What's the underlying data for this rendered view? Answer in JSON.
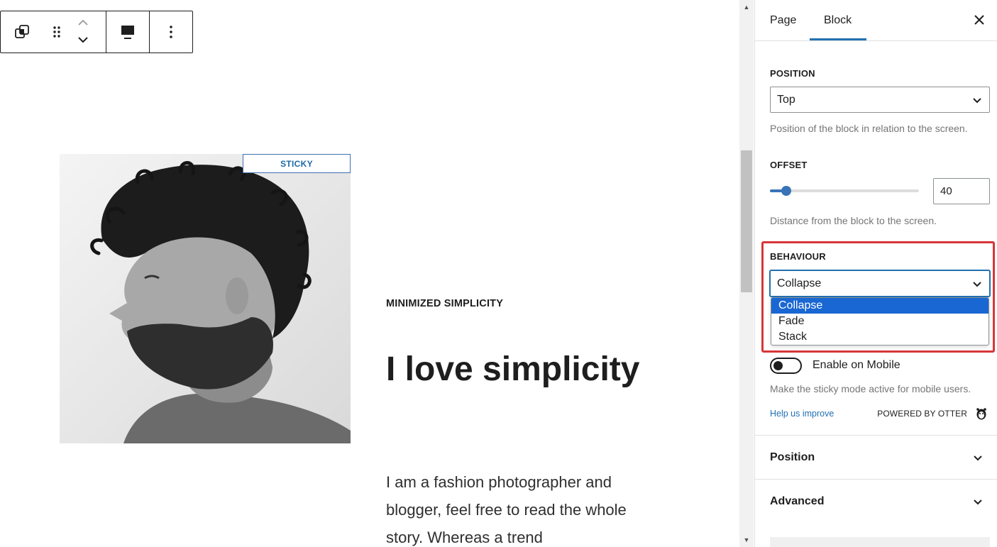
{
  "toolbar": {
    "icons": [
      "duplicate-blocks-icon",
      "drag-handle-icon",
      "move-up-icon",
      "move-down-icon",
      "block-align-icon",
      "more-options-icon"
    ]
  },
  "canvas": {
    "badge": "STICKY",
    "eyebrow": "MINIMIZED SIMPLICITY",
    "headline": "I love simplicity",
    "body": "I am a fashion photographer and blogger, feel free to read the whole story. Whereas a trend"
  },
  "sidebar": {
    "tabs": [
      {
        "label": "Page",
        "active": false
      },
      {
        "label": "Block",
        "active": true
      }
    ],
    "position": {
      "label": "POSITION",
      "value": "Top",
      "help": "Position of the block in relation to the screen."
    },
    "offset": {
      "label": "OFFSET",
      "value": "40",
      "slider_fraction": 0.08,
      "help": "Distance from the block to the screen."
    },
    "behaviour": {
      "label": "BEHAVIOUR",
      "value": "Collapse",
      "options": [
        "Collapse",
        "Fade",
        "Stack"
      ],
      "selected_index": 0
    },
    "mobile": {
      "label": "Enable on Mobile",
      "enabled": false,
      "help": "Make the sticky mode active for mobile users."
    },
    "footer": {
      "help_link": "Help us improve",
      "powered": "POWERED BY OTTER"
    },
    "panels": [
      "Position",
      "Advanced"
    ]
  },
  "colors": {
    "accent": "#2271b1",
    "highlight": "#d63638",
    "option_selected": "#1967d2",
    "badge_text": "#1e6aa8"
  }
}
